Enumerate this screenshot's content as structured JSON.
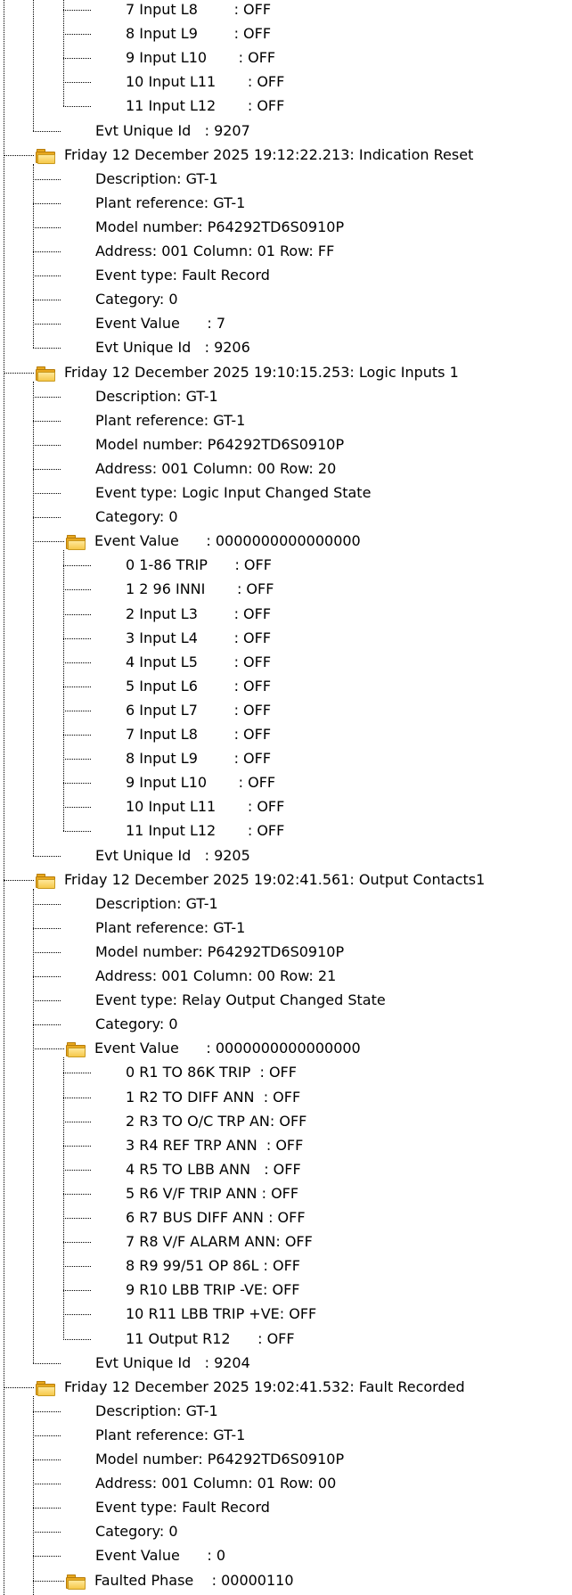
{
  "tree": {
    "rows": [
      {
        "level": 3,
        "text": "7 Input L8        : OFF"
      },
      {
        "level": 3,
        "text": "8 Input L9        : OFF"
      },
      {
        "level": 3,
        "text": "9 Input L10       : OFF"
      },
      {
        "level": 3,
        "text": "10 Input L11       : OFF"
      },
      {
        "level": 3,
        "text": "11 Input L12       : OFF"
      },
      {
        "level": 2,
        "text": "Evt Unique Id   : 9207"
      },
      {
        "level": 1,
        "text": "Friday 12 December 2025 19:12:22.213: Indication Reset",
        "icon": "folder-icon"
      },
      {
        "level": 2,
        "text": "Description: GT-1"
      },
      {
        "level": 2,
        "text": "Plant reference: GT-1"
      },
      {
        "level": 2,
        "text": "Model number: P64292TD6S0910P"
      },
      {
        "level": 2,
        "text": "Address: 001 Column: 01 Row: FF"
      },
      {
        "level": 2,
        "text": "Event type: Fault Record"
      },
      {
        "level": 2,
        "text": "Category: 0"
      },
      {
        "level": 2,
        "text": "Event Value      : 7"
      },
      {
        "level": 2,
        "text": "Evt Unique Id   : 9206"
      },
      {
        "level": 1,
        "text": "Friday 12 December 2025 19:10:15.253: Logic Inputs 1",
        "icon": "folder-icon"
      },
      {
        "level": 2,
        "text": "Description: GT-1"
      },
      {
        "level": 2,
        "text": "Plant reference: GT-1"
      },
      {
        "level": 2,
        "text": "Model number: P64292TD6S0910P"
      },
      {
        "level": 2,
        "text": "Address: 001 Column: 00 Row: 20"
      },
      {
        "level": 2,
        "text": "Event type: Logic Input Changed State"
      },
      {
        "level": 2,
        "text": "Category: 0"
      },
      {
        "level": 2,
        "text": "Event Value      : 0000000000000000",
        "icon": "folder-icon"
      },
      {
        "level": 3,
        "text": "0 1-86 TRIP      : OFF"
      },
      {
        "level": 3,
        "text": "1 2 96 INNI       : OFF"
      },
      {
        "level": 3,
        "text": "2 Input L3        : OFF"
      },
      {
        "level": 3,
        "text": "3 Input L4        : OFF"
      },
      {
        "level": 3,
        "text": "4 Input L5        : OFF"
      },
      {
        "level": 3,
        "text": "5 Input L6        : OFF"
      },
      {
        "level": 3,
        "text": "6 Input L7        : OFF"
      },
      {
        "level": 3,
        "text": "7 Input L8        : OFF"
      },
      {
        "level": 3,
        "text": "8 Input L9        : OFF"
      },
      {
        "level": 3,
        "text": "9 Input L10       : OFF"
      },
      {
        "level": 3,
        "text": "10 Input L11       : OFF"
      },
      {
        "level": 3,
        "text": "11 Input L12       : OFF"
      },
      {
        "level": 2,
        "text": "Evt Unique Id   : 9205"
      },
      {
        "level": 1,
        "text": "Friday 12 December 2025 19:02:41.561: Output Contacts1",
        "icon": "folder-icon"
      },
      {
        "level": 2,
        "text": "Description: GT-1"
      },
      {
        "level": 2,
        "text": "Plant reference: GT-1"
      },
      {
        "level": 2,
        "text": "Model number: P64292TD6S0910P"
      },
      {
        "level": 2,
        "text": "Address: 001 Column: 00 Row: 21"
      },
      {
        "level": 2,
        "text": "Event type: Relay Output Changed State"
      },
      {
        "level": 2,
        "text": "Category: 0"
      },
      {
        "level": 2,
        "text": "Event Value      : 0000000000000000",
        "icon": "folder-icon"
      },
      {
        "level": 3,
        "text": "0 R1 TO 86K TRIP  : OFF"
      },
      {
        "level": 3,
        "text": "1 R2 TO DIFF ANN  : OFF"
      },
      {
        "level": 3,
        "text": "2 R3 TO O/C TRP AN: OFF"
      },
      {
        "level": 3,
        "text": "3 R4 REF TRP ANN  : OFF"
      },
      {
        "level": 3,
        "text": "4 R5 TO LBB ANN   : OFF"
      },
      {
        "level": 3,
        "text": "5 R6 V/F TRIP ANN : OFF"
      },
      {
        "level": 3,
        "text": "6 R7 BUS DIFF ANN : OFF"
      },
      {
        "level": 3,
        "text": "7 R8 V/F ALARM ANN: OFF"
      },
      {
        "level": 3,
        "text": "8 R9 99/51 OP 86L : OFF"
      },
      {
        "level": 3,
        "text": "9 R10 LBB TRIP -VE: OFF"
      },
      {
        "level": 3,
        "text": "10 R11 LBB TRIP +VE: OFF"
      },
      {
        "level": 3,
        "text": "11 Output R12      : OFF"
      },
      {
        "level": 2,
        "text": "Evt Unique Id   : 9204"
      },
      {
        "level": 1,
        "text": "Friday 12 December 2025 19:02:41.532: Fault Recorded",
        "icon": "folder-icon"
      },
      {
        "level": 2,
        "text": "Description: GT-1"
      },
      {
        "level": 2,
        "text": "Plant reference: GT-1"
      },
      {
        "level": 2,
        "text": "Model number: P64292TD6S0910P"
      },
      {
        "level": 2,
        "text": "Address: 001 Column: 01 Row: 00"
      },
      {
        "level": 2,
        "text": "Event type: Fault Record"
      },
      {
        "level": 2,
        "text": "Category: 0"
      },
      {
        "level": 2,
        "text": "Event Value      : 0"
      },
      {
        "level": 2,
        "text": "Faulted Phase    : 00000110",
        "icon": "folder-icon"
      }
    ]
  }
}
